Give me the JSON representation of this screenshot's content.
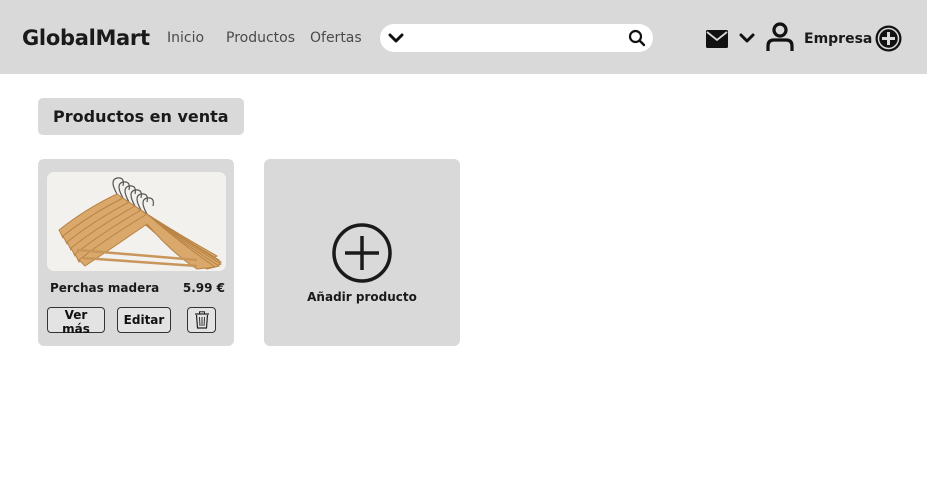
{
  "header": {
    "brand": "GlobalMart",
    "nav": [
      {
        "label": "Inicio"
      },
      {
        "label": "Productos"
      },
      {
        "label": "Ofertas"
      }
    ],
    "search": {
      "value": "",
      "placeholder": ""
    },
    "account_label": "Empresa",
    "icons": [
      "chevron-down-icon",
      "search-icon",
      "mail-icon",
      "chevron-down-icon",
      "user-icon",
      "add-circle-icon"
    ]
  },
  "main": {
    "section_title": "Productos en venta",
    "products": [
      {
        "name": "Perchas madera",
        "price": "5.99 €",
        "view_label": "Ver más",
        "edit_label": "Editar",
        "delete_icon": "trash-icon"
      }
    ],
    "add_product_label": "Añadir producto"
  },
  "colors": {
    "header_bg": "#d9d9d9",
    "card_bg": "#d9d9d9",
    "page_bg": "#ffffff",
    "text": "#1a1a1a"
  }
}
